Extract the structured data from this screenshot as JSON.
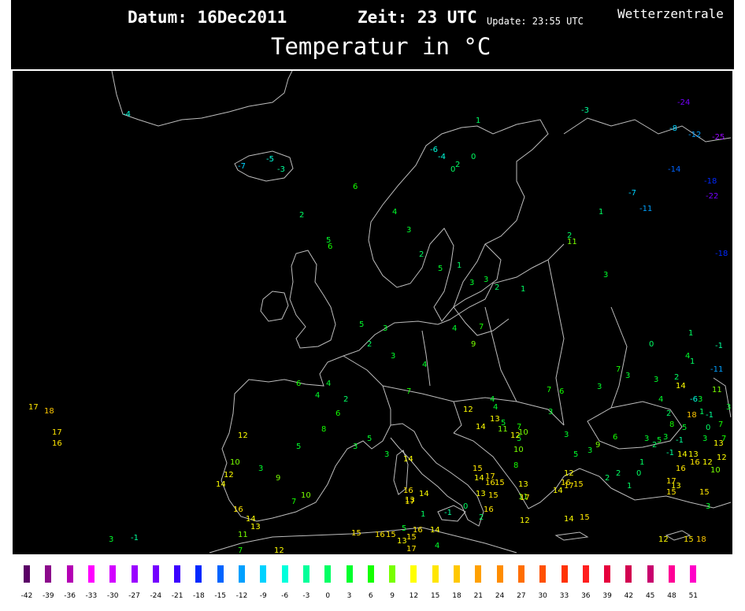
{
  "header": {
    "datum": "Datum: 16Dec2011",
    "zeit": "Zeit: 23 UTC",
    "update": "Update: 23:55 UTC",
    "source": "Wetterzentrale",
    "title": "Temperatur in °C"
  },
  "colors": {
    "background": "#000000",
    "coastline": "#bdbdbd",
    "frame": "#ffffff"
  },
  "legend": {
    "ticks": [
      "-42",
      "-39",
      "-36",
      "-33",
      "-30",
      "-27",
      "-24",
      "-21",
      "-18",
      "-15",
      "-12",
      "-9",
      "-6",
      "-3",
      "0",
      "3",
      "6",
      "9",
      "12",
      "15",
      "18",
      "21",
      "24",
      "27",
      "30",
      "33",
      "36",
      "39",
      "42",
      "45",
      "48",
      "51"
    ],
    "colors": [
      "#5a0066",
      "#8b0a8b",
      "#b400b4",
      "#ff00ff",
      "#d200ff",
      "#9a00ff",
      "#7400ff",
      "#3c00ff",
      "#0028ff",
      "#0064ff",
      "#00a0ff",
      "#00d2ff",
      "#00ffdc",
      "#00ff9a",
      "#00ff64",
      "#00ff2c",
      "#14ff00",
      "#78ff00",
      "#ffff00",
      "#ffe600",
      "#ffc800",
      "#ffa000",
      "#ff8c00",
      "#ff6e00",
      "#ff5000",
      "#ff3200",
      "#ff1e1e",
      "#e6003c",
      "#d20050",
      "#c8006e",
      "#ff0096",
      "#ff00c8"
    ]
  },
  "stations": [
    {
      "v": "-4"
    },
    {
      "v": "-5"
    },
    {
      "v": "-3"
    },
    {
      "v": "-7"
    },
    {
      "v": "6"
    },
    {
      "v": "2"
    },
    {
      "v": "5"
    },
    {
      "v": "6"
    },
    {
      "v": "-3"
    },
    {
      "v": "-24"
    },
    {
      "v": "-8"
    },
    {
      "v": "-12"
    },
    {
      "v": "-25"
    },
    {
      "v": "-14"
    },
    {
      "v": "-7"
    },
    {
      "v": "-18"
    },
    {
      "v": "-22"
    },
    {
      "v": "-11"
    },
    {
      "v": "-18"
    },
    {
      "v": "1"
    },
    {
      "v": "11"
    },
    {
      "v": "2"
    },
    {
      "v": "3"
    },
    {
      "v": "-6"
    },
    {
      "v": "-4"
    },
    {
      "v": "0"
    },
    {
      "v": "2"
    },
    {
      "v": "0"
    },
    {
      "v": "1"
    },
    {
      "v": "4"
    },
    {
      "v": "3"
    },
    {
      "v": "2"
    },
    {
      "v": "5"
    },
    {
      "v": "1"
    },
    {
      "v": "3"
    },
    {
      "v": "7"
    },
    {
      "v": "4"
    },
    {
      "v": "9"
    },
    {
      "v": "4"
    },
    {
      "v": "3"
    },
    {
      "v": "2"
    },
    {
      "v": "3"
    },
    {
      "v": "5"
    },
    {
      "v": "7"
    },
    {
      "v": "5"
    },
    {
      "v": "3"
    },
    {
      "v": "4"
    },
    {
      "v": "6"
    },
    {
      "v": "2"
    },
    {
      "v": "4"
    },
    {
      "v": "8"
    },
    {
      "v": "5"
    },
    {
      "v": "6"
    },
    {
      "v": "3"
    },
    {
      "v": "2"
    },
    {
      "v": "1"
    },
    {
      "v": "3"
    },
    {
      "v": "0"
    },
    {
      "v": "-1"
    },
    {
      "v": "1"
    },
    {
      "v": "3"
    },
    {
      "v": "7"
    },
    {
      "v": "4"
    },
    {
      "v": "3"
    },
    {
      "v": "2"
    },
    {
      "v": "1"
    },
    {
      "v": "3"
    },
    {
      "v": "7"
    },
    {
      "v": "4"
    },
    {
      "v": "14"
    },
    {
      "v": "-6"
    },
    {
      "v": "-1"
    },
    {
      "v": "0"
    },
    {
      "v": "-11"
    },
    {
      "v": "6"
    },
    {
      "v": "3"
    },
    {
      "v": "7"
    },
    {
      "v": "5"
    },
    {
      "v": "3"
    },
    {
      "v": "9"
    },
    {
      "v": "3"
    },
    {
      "v": "5"
    },
    {
      "v": "4"
    },
    {
      "v": "12"
    },
    {
      "v": "14"
    },
    {
      "v": "13"
    },
    {
      "v": "11"
    },
    {
      "v": "12"
    },
    {
      "v": "10"
    },
    {
      "v": "10"
    },
    {
      "v": "8"
    },
    {
      "v": "13"
    },
    {
      "v": "11"
    },
    {
      "v": "12"
    },
    {
      "v": "17"
    },
    {
      "v": "18"
    },
    {
      "v": "17"
    },
    {
      "v": "16"
    },
    {
      "v": "12"
    },
    {
      "v": "10"
    },
    {
      "v": "12"
    },
    {
      "v": "14"
    },
    {
      "v": "3"
    },
    {
      "v": "9"
    },
    {
      "v": "7"
    },
    {
      "v": "10"
    },
    {
      "v": "14"
    },
    {
      "v": "16"
    },
    {
      "v": "13"
    },
    {
      "v": "14"
    },
    {
      "v": "15"
    },
    {
      "v": "17"
    },
    {
      "v": "16"
    },
    {
      "v": "15"
    },
    {
      "v": "14"
    },
    {
      "v": "17"
    },
    {
      "v": "16"
    },
    {
      "v": "13"
    },
    {
      "v": "15"
    },
    {
      "v": "15"
    },
    {
      "v": "17"
    },
    {
      "v": "17"
    },
    {
      "v": "12"
    },
    {
      "v": "14"
    },
    {
      "v": "15"
    },
    {
      "v": "16"
    },
    {
      "v": "14"
    },
    {
      "v": "15"
    },
    {
      "v": "15"
    },
    {
      "v": "13"
    },
    {
      "v": "17"
    },
    {
      "v": "16"
    },
    {
      "v": "13"
    },
    {
      "v": "12"
    },
    {
      "v": "15"
    },
    {
      "v": "18"
    },
    {
      "v": "16"
    },
    {
      "v": "14"
    },
    {
      "v": "13"
    },
    {
      "v": "11"
    },
    {
      "v": "7"
    },
    {
      "v": "12"
    },
    {
      "v": "15"
    },
    {
      "v": "16"
    },
    {
      "v": "15"
    },
    {
      "v": "13"
    },
    {
      "v": "17"
    },
    {
      "v": "16"
    },
    {
      "v": "14"
    },
    {
      "v": "4"
    },
    {
      "v": "5"
    },
    {
      "v": "1"
    },
    {
      "v": "-1"
    },
    {
      "v": "0"
    },
    {
      "v": "2"
    },
    {
      "v": "-1"
    },
    {
      "v": "3"
    },
    {
      "v": "3"
    },
    {
      "v": "10"
    },
    {
      "v": "13"
    },
    {
      "v": "15"
    },
    {
      "v": "18"
    },
    {
      "v": "5"
    },
    {
      "v": "3"
    },
    {
      "v": "2"
    },
    {
      "v": "4"
    },
    {
      "v": "14"
    },
    {
      "v": "16"
    },
    {
      "v": "12"
    },
    {
      "v": "12"
    },
    {
      "v": "7"
    },
    {
      "v": "1"
    },
    {
      "v": "8"
    },
    {
      "v": "3"
    },
    {
      "v": "5"
    },
    {
      "v": "6"
    },
    {
      "v": "-1"
    },
    {
      "v": "-1"
    },
    {
      "v": "7"
    },
    {
      "v": "11"
    },
    {
      "v": "3"
    },
    {
      "v": "3"
    },
    {
      "v": "2"
    },
    {
      "v": "2"
    },
    {
      "v": "1"
    },
    {
      "v": "0"
    },
    {
      "v": "1"
    },
    {
      "v": "2"
    },
    {
      "v": "3"
    },
    {
      "v": "5"
    }
  ]
}
